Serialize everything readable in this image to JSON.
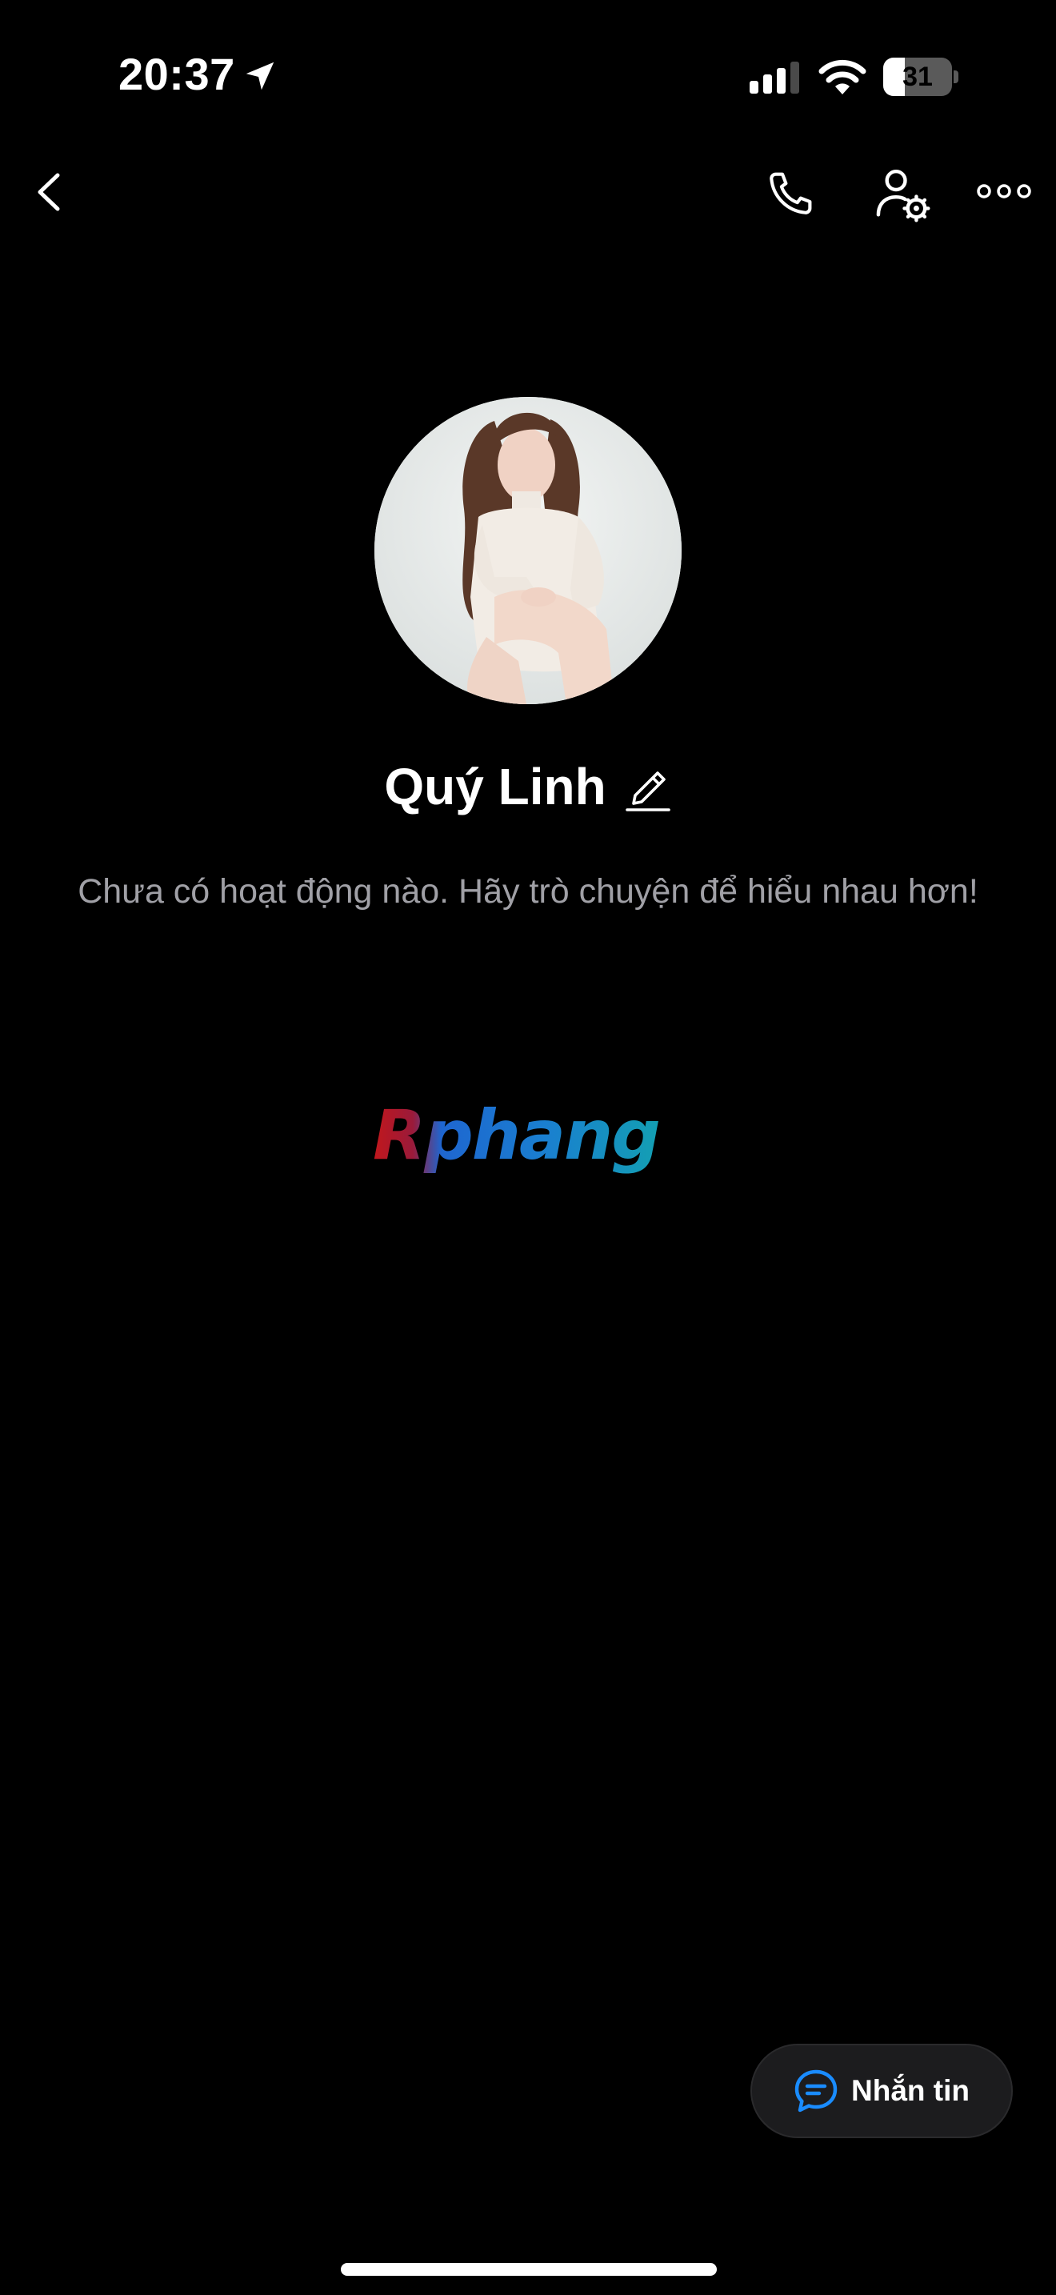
{
  "status_bar": {
    "time": "20:37",
    "battery_level": 31,
    "battery_text": "31",
    "icons": [
      "location-arrow-icon",
      "cellular-signal-icon",
      "wifi-icon",
      "battery-icon"
    ]
  },
  "nav": {
    "icons": [
      "back-chevron-icon",
      "phone-call-icon",
      "contact-settings-icon",
      "more-dots-icon"
    ]
  },
  "profile": {
    "name": "Quý Linh",
    "empty_message": "Chưa có hoạt động nào. Hãy trò chuyện để hiểu nhau hơn!"
  },
  "watermark": {
    "text": "Rphang",
    "colors": [
      "#c2171c",
      "#1e66d0",
      "#139fb3"
    ]
  },
  "message_button": {
    "label": "Nhắn tin",
    "icon": "chat-bubble-icon",
    "accent": "#1a8cff"
  }
}
